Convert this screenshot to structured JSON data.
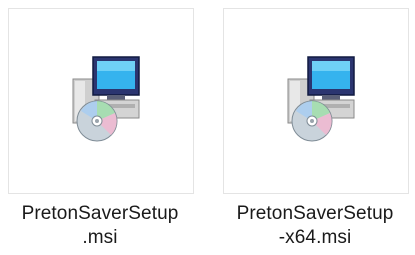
{
  "files": [
    {
      "name_line1": "PretonSaverSetup",
      "name_line2": ".msi",
      "icon": "msi-installer-icon"
    },
    {
      "name_line1": "PretonSaverSetup",
      "name_line2": "-x64.msi",
      "icon": "msi-installer-icon"
    }
  ],
  "colors": {
    "monitor_frame": "#1f2a5a",
    "screen": "#2fa8e6",
    "box": "#d9d9d9",
    "disc": "#c8d2da"
  }
}
